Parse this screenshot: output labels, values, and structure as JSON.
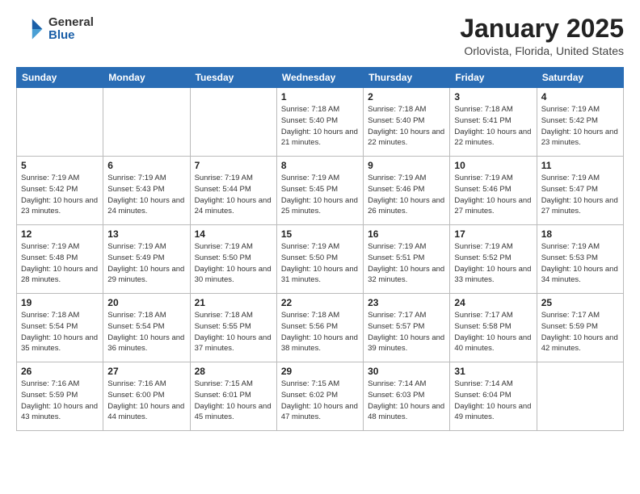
{
  "header": {
    "logo_general": "General",
    "logo_blue": "Blue",
    "title": "January 2025",
    "subtitle": "Orlovista, Florida, United States"
  },
  "weekdays": [
    "Sunday",
    "Monday",
    "Tuesday",
    "Wednesday",
    "Thursday",
    "Friday",
    "Saturday"
  ],
  "weeks": [
    [
      {
        "day": "",
        "sunrise": "",
        "sunset": "",
        "daylight": "",
        "empty": true
      },
      {
        "day": "",
        "sunrise": "",
        "sunset": "",
        "daylight": "",
        "empty": true
      },
      {
        "day": "",
        "sunrise": "",
        "sunset": "",
        "daylight": "",
        "empty": true
      },
      {
        "day": "1",
        "sunrise": "Sunrise: 7:18 AM",
        "sunset": "Sunset: 5:40 PM",
        "daylight": "Daylight: 10 hours and 21 minutes.",
        "empty": false
      },
      {
        "day": "2",
        "sunrise": "Sunrise: 7:18 AM",
        "sunset": "Sunset: 5:40 PM",
        "daylight": "Daylight: 10 hours and 22 minutes.",
        "empty": false
      },
      {
        "day": "3",
        "sunrise": "Sunrise: 7:18 AM",
        "sunset": "Sunset: 5:41 PM",
        "daylight": "Daylight: 10 hours and 22 minutes.",
        "empty": false
      },
      {
        "day": "4",
        "sunrise": "Sunrise: 7:19 AM",
        "sunset": "Sunset: 5:42 PM",
        "daylight": "Daylight: 10 hours and 23 minutes.",
        "empty": false
      }
    ],
    [
      {
        "day": "5",
        "sunrise": "Sunrise: 7:19 AM",
        "sunset": "Sunset: 5:42 PM",
        "daylight": "Daylight: 10 hours and 23 minutes.",
        "empty": false
      },
      {
        "day": "6",
        "sunrise": "Sunrise: 7:19 AM",
        "sunset": "Sunset: 5:43 PM",
        "daylight": "Daylight: 10 hours and 24 minutes.",
        "empty": false
      },
      {
        "day": "7",
        "sunrise": "Sunrise: 7:19 AM",
        "sunset": "Sunset: 5:44 PM",
        "daylight": "Daylight: 10 hours and 24 minutes.",
        "empty": false
      },
      {
        "day": "8",
        "sunrise": "Sunrise: 7:19 AM",
        "sunset": "Sunset: 5:45 PM",
        "daylight": "Daylight: 10 hours and 25 minutes.",
        "empty": false
      },
      {
        "day": "9",
        "sunrise": "Sunrise: 7:19 AM",
        "sunset": "Sunset: 5:46 PM",
        "daylight": "Daylight: 10 hours and 26 minutes.",
        "empty": false
      },
      {
        "day": "10",
        "sunrise": "Sunrise: 7:19 AM",
        "sunset": "Sunset: 5:46 PM",
        "daylight": "Daylight: 10 hours and 27 minutes.",
        "empty": false
      },
      {
        "day": "11",
        "sunrise": "Sunrise: 7:19 AM",
        "sunset": "Sunset: 5:47 PM",
        "daylight": "Daylight: 10 hours and 27 minutes.",
        "empty": false
      }
    ],
    [
      {
        "day": "12",
        "sunrise": "Sunrise: 7:19 AM",
        "sunset": "Sunset: 5:48 PM",
        "daylight": "Daylight: 10 hours and 28 minutes.",
        "empty": false
      },
      {
        "day": "13",
        "sunrise": "Sunrise: 7:19 AM",
        "sunset": "Sunset: 5:49 PM",
        "daylight": "Daylight: 10 hours and 29 minutes.",
        "empty": false
      },
      {
        "day": "14",
        "sunrise": "Sunrise: 7:19 AM",
        "sunset": "Sunset: 5:50 PM",
        "daylight": "Daylight: 10 hours and 30 minutes.",
        "empty": false
      },
      {
        "day": "15",
        "sunrise": "Sunrise: 7:19 AM",
        "sunset": "Sunset: 5:50 PM",
        "daylight": "Daylight: 10 hours and 31 minutes.",
        "empty": false
      },
      {
        "day": "16",
        "sunrise": "Sunrise: 7:19 AM",
        "sunset": "Sunset: 5:51 PM",
        "daylight": "Daylight: 10 hours and 32 minutes.",
        "empty": false
      },
      {
        "day": "17",
        "sunrise": "Sunrise: 7:19 AM",
        "sunset": "Sunset: 5:52 PM",
        "daylight": "Daylight: 10 hours and 33 minutes.",
        "empty": false
      },
      {
        "day": "18",
        "sunrise": "Sunrise: 7:19 AM",
        "sunset": "Sunset: 5:53 PM",
        "daylight": "Daylight: 10 hours and 34 minutes.",
        "empty": false
      }
    ],
    [
      {
        "day": "19",
        "sunrise": "Sunrise: 7:18 AM",
        "sunset": "Sunset: 5:54 PM",
        "daylight": "Daylight: 10 hours and 35 minutes.",
        "empty": false
      },
      {
        "day": "20",
        "sunrise": "Sunrise: 7:18 AM",
        "sunset": "Sunset: 5:54 PM",
        "daylight": "Daylight: 10 hours and 36 minutes.",
        "empty": false
      },
      {
        "day": "21",
        "sunrise": "Sunrise: 7:18 AM",
        "sunset": "Sunset: 5:55 PM",
        "daylight": "Daylight: 10 hours and 37 minutes.",
        "empty": false
      },
      {
        "day": "22",
        "sunrise": "Sunrise: 7:18 AM",
        "sunset": "Sunset: 5:56 PM",
        "daylight": "Daylight: 10 hours and 38 minutes.",
        "empty": false
      },
      {
        "day": "23",
        "sunrise": "Sunrise: 7:17 AM",
        "sunset": "Sunset: 5:57 PM",
        "daylight": "Daylight: 10 hours and 39 minutes.",
        "empty": false
      },
      {
        "day": "24",
        "sunrise": "Sunrise: 7:17 AM",
        "sunset": "Sunset: 5:58 PM",
        "daylight": "Daylight: 10 hours and 40 minutes.",
        "empty": false
      },
      {
        "day": "25",
        "sunrise": "Sunrise: 7:17 AM",
        "sunset": "Sunset: 5:59 PM",
        "daylight": "Daylight: 10 hours and 42 minutes.",
        "empty": false
      }
    ],
    [
      {
        "day": "26",
        "sunrise": "Sunrise: 7:16 AM",
        "sunset": "Sunset: 5:59 PM",
        "daylight": "Daylight: 10 hours and 43 minutes.",
        "empty": false
      },
      {
        "day": "27",
        "sunrise": "Sunrise: 7:16 AM",
        "sunset": "Sunset: 6:00 PM",
        "daylight": "Daylight: 10 hours and 44 minutes.",
        "empty": false
      },
      {
        "day": "28",
        "sunrise": "Sunrise: 7:15 AM",
        "sunset": "Sunset: 6:01 PM",
        "daylight": "Daylight: 10 hours and 45 minutes.",
        "empty": false
      },
      {
        "day": "29",
        "sunrise": "Sunrise: 7:15 AM",
        "sunset": "Sunset: 6:02 PM",
        "daylight": "Daylight: 10 hours and 47 minutes.",
        "empty": false
      },
      {
        "day": "30",
        "sunrise": "Sunrise: 7:14 AM",
        "sunset": "Sunset: 6:03 PM",
        "daylight": "Daylight: 10 hours and 48 minutes.",
        "empty": false
      },
      {
        "day": "31",
        "sunrise": "Sunrise: 7:14 AM",
        "sunset": "Sunset: 6:04 PM",
        "daylight": "Daylight: 10 hours and 49 minutes.",
        "empty": false
      },
      {
        "day": "",
        "sunrise": "",
        "sunset": "",
        "daylight": "",
        "empty": true
      }
    ]
  ]
}
